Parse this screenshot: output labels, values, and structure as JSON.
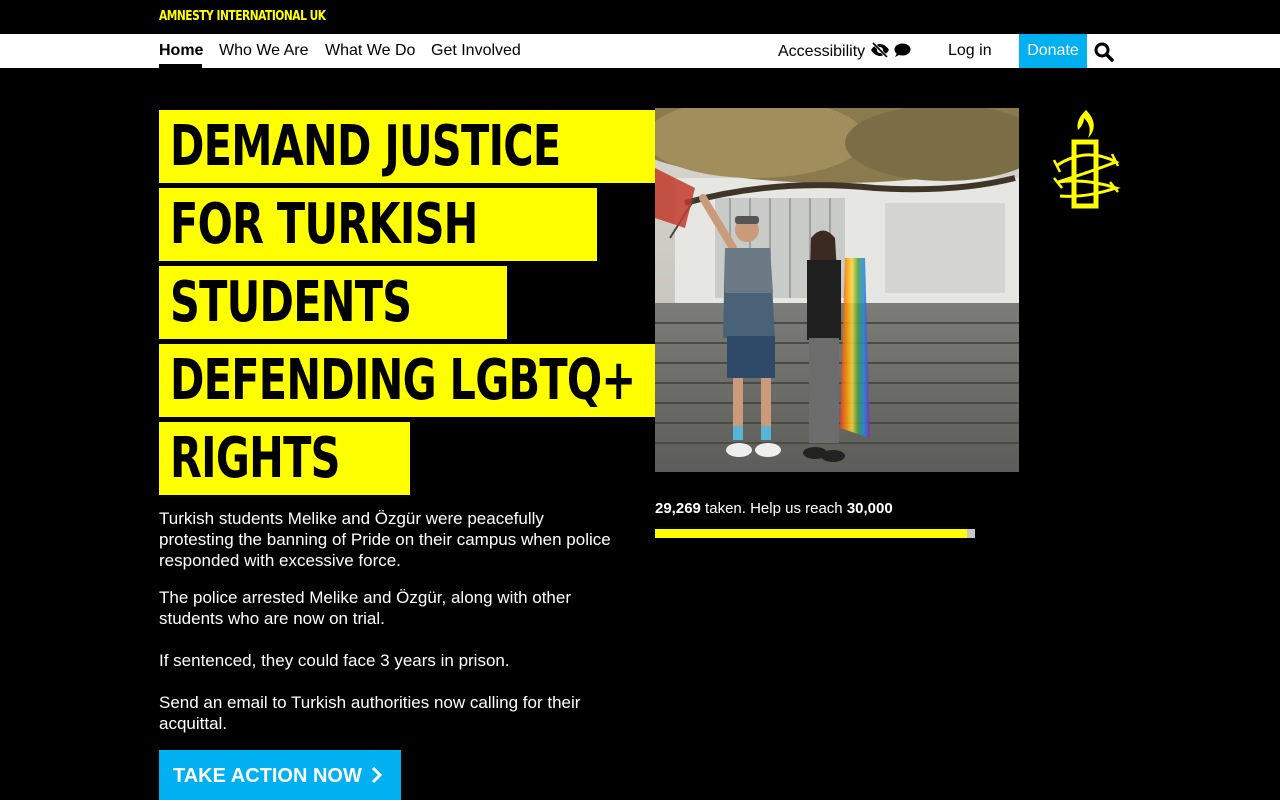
{
  "brand": "AMNESTY INTERNATIONAL UK",
  "nav": {
    "items": [
      "Home",
      "Who We Are",
      "What We Do",
      "Get Involved"
    ],
    "accessibility": "Accessibility",
    "login": "Log in",
    "donate": "Donate"
  },
  "headline": [
    "DEMAND JUSTICE",
    "FOR TURKISH",
    "STUDENTS",
    "DEFENDING LGBTQ+",
    "RIGHTS"
  ],
  "paragraphs": [
    "Turkish students Melike and Özgür were peacefully protesting the banning of Pride on their campus when police responded with excessive force.",
    "The police arrested Melike and Özgür, along with other students who are now on trial.",
    "If sentenced, they could face 3 years in prison.",
    "Send an email to Turkish authorities now calling for their acquittal."
  ],
  "cta": "TAKE ACTION NOW",
  "progress": {
    "taken": "29,269",
    "middle": " taken. Help us reach ",
    "goal": "30,000",
    "fraction": 0.9756
  },
  "colors": {
    "accent_yellow": "#ffff00",
    "donate_blue": "#00b0f0",
    "background": "#000000"
  }
}
